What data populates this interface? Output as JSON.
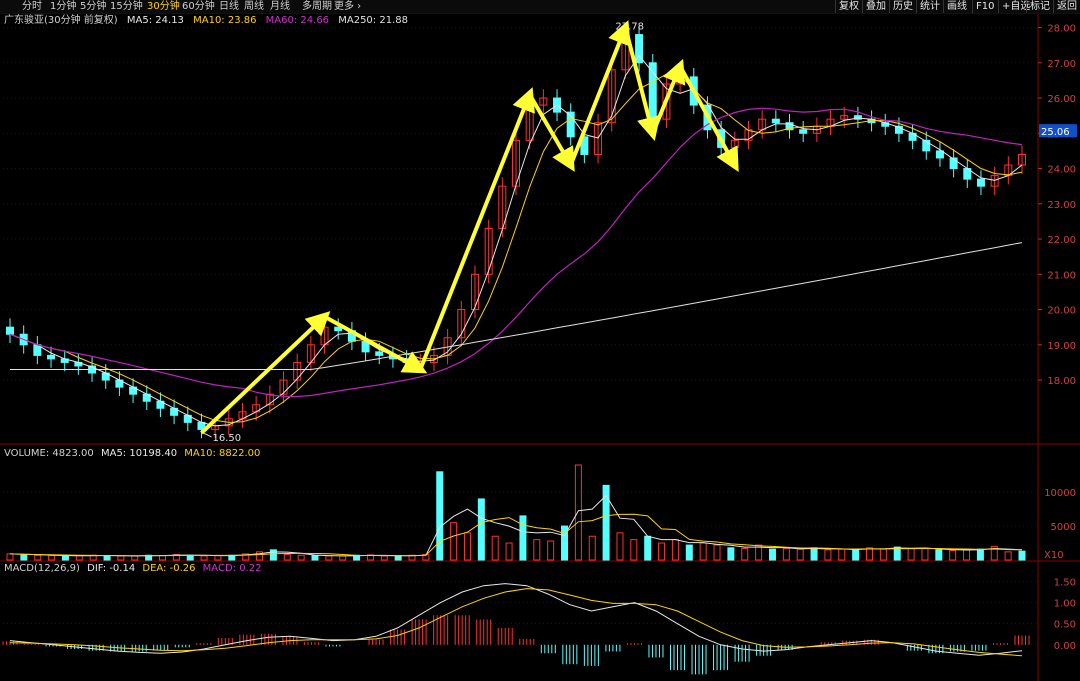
{
  "toolbar": {
    "tabs": [
      "分时",
      "1分钟",
      "5分钟",
      "15分钟",
      "30分钟",
      "60分钟",
      "日线",
      "周线",
      "月线",
      "多周期",
      "更多 ›"
    ],
    "active_tab": "30分钟",
    "right_buttons": [
      "复权",
      "叠加",
      "历史",
      "统计",
      "画线",
      "F10",
      "+自选",
      "标记",
      "返回"
    ]
  },
  "header": {
    "title": "广东骏亚(30分钟 前复权)",
    "ma5": "MA5: 24.13",
    "ma10": "MA10: 23.86",
    "ma60": "MA60: 24.66",
    "ma250": "MA250: 21.88"
  },
  "volume_header": {
    "label": "VOLUME: 4823.00",
    "ma5": "MA5: 10198.40",
    "ma10": "MA10: 8822.00"
  },
  "macd_header": {
    "label": "MACD(12,26,9)",
    "dif": "DIF: -0.14",
    "dea": "DEA: -0.26",
    "macd": "MACD: 0.22"
  },
  "colors": {
    "up": "#ff3030",
    "down": "#54ffff",
    "ma5": "#e8e8e8",
    "ma10": "#ffd400",
    "ma60": "#c020c0",
    "ma250": "#e0e0e0",
    "arrow": "#ffff33",
    "grid": "#6a0000",
    "axis_text": "#d04040",
    "current_price_bg": "#1050c8"
  },
  "chart_data": [
    {
      "type": "candlestick",
      "title": "广东骏亚(30分钟 前复权)",
      "yticks": [
        18.0,
        19.0,
        20.0,
        21.0,
        22.0,
        23.0,
        24.0,
        25.0,
        26.0,
        27.0,
        28.0
      ],
      "ylim": [
        16.3,
        28.1
      ],
      "current_price": "25.06",
      "annotations": {
        "low_label": "16.50",
        "high_label": "27.78"
      },
      "arrow_path_prices": [
        16.5,
        19.8,
        18.3,
        26.1,
        24.1,
        28.0,
        25.0,
        26.9,
        24.1
      ],
      "close_series": [
        19.3,
        19.0,
        18.7,
        18.6,
        18.5,
        18.4,
        18.2,
        18.0,
        17.8,
        17.6,
        17.4,
        17.2,
        17.0,
        16.8,
        16.6,
        16.7,
        16.9,
        17.1,
        17.3,
        17.6,
        18.0,
        18.5,
        19.0,
        19.5,
        19.4,
        19.1,
        18.8,
        18.7,
        18.6,
        18.5,
        18.5,
        18.7,
        19.2,
        20.0,
        21.0,
        22.3,
        23.5,
        24.8,
        25.8,
        26.0,
        25.6,
        24.9,
        24.4,
        25.3,
        26.8,
        27.8,
        27.0,
        25.4,
        26.4,
        26.6,
        25.8,
        25.1,
        24.6,
        24.8,
        25.1,
        25.4,
        25.3,
        25.1,
        25.0,
        25.2,
        25.4,
        25.5,
        25.4,
        25.3,
        25.2,
        25.0,
        24.8,
        24.5,
        24.3,
        24.0,
        23.7,
        23.5,
        23.8,
        24.1,
        24.4
      ]
    },
    {
      "type": "bar",
      "title": "VOLUME",
      "yticks": [
        5000,
        10000
      ],
      "ylim": [
        0,
        14000
      ],
      "unit_label": "X10",
      "values": [
        900,
        800,
        700,
        650,
        600,
        620,
        700,
        650,
        600,
        580,
        700,
        650,
        800,
        700,
        600,
        650,
        700,
        900,
        1200,
        1500,
        800,
        700,
        650,
        600,
        580,
        700,
        750,
        600,
        600,
        700,
        800,
        13000,
        5500,
        4000,
        9000,
        3500,
        2500,
        6500,
        3000,
        2800,
        5000,
        14000,
        3500,
        11000,
        4000,
        3000,
        3500,
        2500,
        3000,
        2200,
        2500,
        2200,
        1800,
        1700,
        2200,
        1600,
        1700,
        1600,
        1800,
        1500,
        1600,
        1500,
        1800,
        1600,
        1900,
        1700,
        1700,
        1500,
        1400,
        1500,
        1600,
        2000,
        1200,
        1300
      ]
    },
    {
      "type": "bar",
      "title": "MACD(12,26,9)",
      "yticks": [
        1.5,
        1.0,
        0.5,
        0.0
      ],
      "ylim": [
        -0.55,
        1.7
      ],
      "dif": [
        0.1,
        0.05,
        0.0,
        -0.05,
        -0.1,
        -0.15,
        -0.18,
        -0.2,
        -0.17,
        -0.1,
        0.0,
        0.1,
        0.18,
        0.2,
        0.15,
        0.1,
        0.12,
        0.2,
        0.4,
        0.7,
        1.0,
        1.25,
        1.4,
        1.45,
        1.4,
        1.2,
        0.95,
        0.8,
        0.9,
        1.0,
        0.8,
        0.5,
        0.2,
        0.0,
        -0.1,
        -0.15,
        -0.12,
        -0.05,
        0.0,
        0.05,
        0.1,
        0.05,
        -0.05,
        -0.15,
        -0.2,
        -0.25,
        -0.2,
        -0.14
      ],
      "dea": [
        0.05,
        0.04,
        0.02,
        0.0,
        -0.03,
        -0.07,
        -0.1,
        -0.13,
        -0.14,
        -0.12,
        -0.08,
        -0.02,
        0.05,
        0.1,
        0.12,
        0.12,
        0.12,
        0.14,
        0.22,
        0.4,
        0.65,
        0.9,
        1.1,
        1.25,
        1.33,
        1.3,
        1.18,
        1.05,
        0.98,
        0.98,
        0.95,
        0.8,
        0.55,
        0.3,
        0.1,
        -0.02,
        -0.06,
        -0.05,
        -0.03,
        0.0,
        0.04,
        0.05,
        0.02,
        -0.05,
        -0.12,
        -0.18,
        -0.22,
        -0.26
      ],
      "macd": [
        0.08,
        0.02,
        -0.04,
        -0.1,
        -0.14,
        -0.16,
        -0.16,
        -0.14,
        -0.06,
        0.04,
        0.16,
        0.24,
        0.26,
        0.2,
        0.06,
        -0.04,
        0.0,
        0.12,
        0.36,
        0.6,
        0.7,
        0.7,
        0.6,
        0.4,
        0.14,
        -0.2,
        -0.46,
        -0.5,
        -0.16,
        0.04,
        -0.3,
        -0.6,
        -0.7,
        -0.6,
        -0.4,
        -0.26,
        -0.12,
        0.0,
        0.06,
        0.1,
        0.12,
        0.0,
        -0.14,
        -0.2,
        -0.16,
        -0.14,
        0.04,
        0.22
      ]
    }
  ]
}
